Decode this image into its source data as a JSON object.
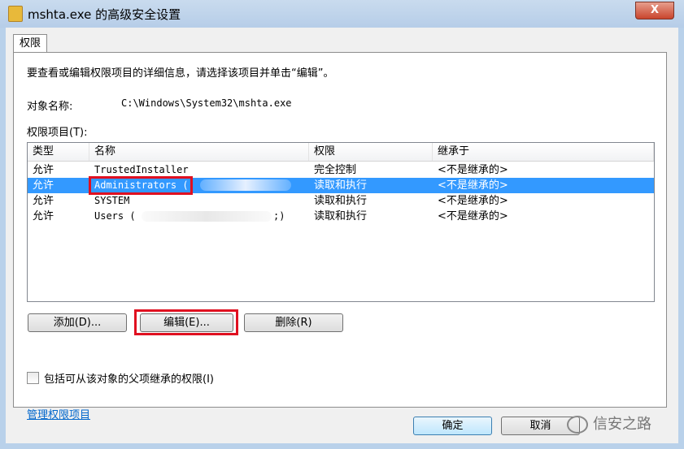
{
  "window": {
    "title": "mshta.exe 的高级安全设置",
    "close_glyph": "X"
  },
  "tabs": [
    {
      "label": "权限"
    }
  ],
  "panel": {
    "description": "要查看或编辑权限项目的详细信息，请选择该项目并单击“编辑”。",
    "object_name_label": "对象名称:",
    "object_name_value": "C:\\Windows\\System32\\mshta.exe",
    "permissions_label": "权限项目(T):"
  },
  "list": {
    "columns": [
      "类型",
      "名称",
      "权限",
      "继承于"
    ],
    "rows": [
      {
        "type": "允许",
        "name": "TrustedInstaller",
        "permission": "完全控制",
        "inherited": "<不是继承的>"
      },
      {
        "type": "允许",
        "name": "Administrators (",
        "permission": "读取和执行",
        "inherited": "<不是继承的>"
      },
      {
        "type": "允许",
        "name": "SYSTEM",
        "permission": "读取和执行",
        "inherited": "<不是继承的>"
      },
      {
        "type": "允许",
        "name": "Users (",
        "name_suffix": ";)",
        "permission": "读取和执行",
        "inherited": "<不是继承的>"
      }
    ],
    "selected_row": 1
  },
  "buttons": {
    "add": "添加(D)...",
    "edit": "编辑(E)...",
    "delete": "删除(R)"
  },
  "checkbox": {
    "label": "包括可从该对象的父项继承的权限(I)",
    "checked": false
  },
  "link": {
    "label": "管理权限项目"
  },
  "footer": {
    "ok": "确定",
    "cancel": "取消"
  },
  "watermark": {
    "text": "信安之路"
  },
  "colors": {
    "selection": "#3399ff",
    "highlight_box": "#e01020",
    "link": "#0066cc"
  }
}
